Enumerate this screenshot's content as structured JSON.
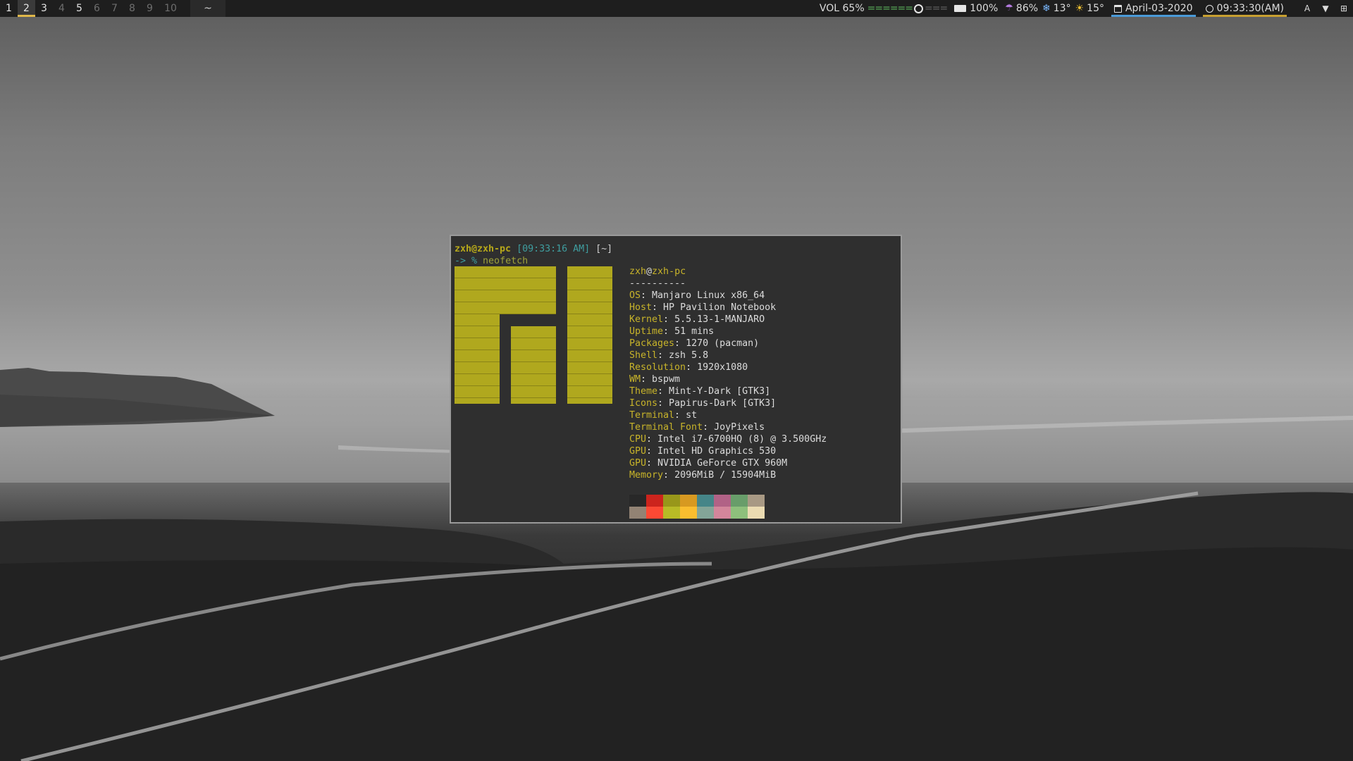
{
  "topbar": {
    "workspaces": [
      {
        "label": "1",
        "state": "occupied"
      },
      {
        "label": "2",
        "state": "active"
      },
      {
        "label": "3",
        "state": "occupied"
      },
      {
        "label": "4",
        "state": "empty"
      },
      {
        "label": "5",
        "state": "occupied"
      },
      {
        "label": "6",
        "state": "empty"
      },
      {
        "label": "7",
        "state": "empty"
      },
      {
        "label": "8",
        "state": "empty"
      },
      {
        "label": "9",
        "state": "empty"
      },
      {
        "label": "10",
        "state": "empty"
      }
    ],
    "window_title": "~",
    "volume": {
      "label": "VOL 65%",
      "level_fraction": 0.65,
      "bar_on": "======",
      "bar_off": "==="
    },
    "battery": {
      "label": "100%",
      "icon": "battery-icon"
    },
    "weather": {
      "humidity": "86%",
      "humidity_icon": "umbrella-icon",
      "low": "13°",
      "low_icon": "snowflake-icon",
      "high": "15°",
      "high_icon": "sun-icon"
    },
    "date": {
      "label": "April-03-2020",
      "icon": "calendar-icon"
    },
    "time": {
      "label": "09:33:30(AM)",
      "icon": "clock-icon"
    },
    "tray": [
      {
        "name": "input-method-icon",
        "glyph": "A"
      },
      {
        "name": "wifi-icon",
        "glyph": "▼"
      },
      {
        "name": "network-icon",
        "glyph": "⊞"
      }
    ],
    "colors": {
      "bar_bg": "#1e1e1e",
      "active_underline": "#e0b84a",
      "date_underline": "#4a9ad8",
      "time_underline": "#c8a030",
      "volume_green": "#5fb85f"
    }
  },
  "terminal": {
    "prompt": {
      "user_host": "zxh@zxh-pc",
      "time": "[09:33:16 AM]",
      "dir": "[~]",
      "arrow": "-> %",
      "command": "neofetch"
    },
    "info": {
      "user": "zxh",
      "at": "@",
      "host": "zxh-pc",
      "separator": "----------",
      "rows": [
        {
          "key": "OS",
          "value": "Manjaro Linux x86_64"
        },
        {
          "key": "Host",
          "value": "HP Pavilion Notebook"
        },
        {
          "key": "Kernel",
          "value": "5.5.13-1-MANJARO"
        },
        {
          "key": "Uptime",
          "value": "51 mins"
        },
        {
          "key": "Packages",
          "value": "1270 (pacman)"
        },
        {
          "key": "Shell",
          "value": "zsh 5.8"
        },
        {
          "key": "Resolution",
          "value": "1920x1080"
        },
        {
          "key": "WM",
          "value": "bspwm"
        },
        {
          "key": "Theme",
          "value": "Mint-Y-Dark [GTK3]"
        },
        {
          "key": "Icons",
          "value": "Papirus-Dark [GTK3]"
        },
        {
          "key": "Terminal",
          "value": "st"
        },
        {
          "key": "Terminal Font",
          "value": "JoyPixels"
        },
        {
          "key": "CPU",
          "value": "Intel i7-6700HQ (8) @ 3.500GHz"
        },
        {
          "key": "GPU",
          "value": "Intel HD Graphics 530"
        },
        {
          "key": "GPU",
          "value": "NVIDIA GeForce GTX 960M"
        },
        {
          "key": "Memory",
          "value": "2096MiB / 15904MiB"
        }
      ]
    },
    "palette": {
      "normal": [
        "#282828",
        "#cc241d",
        "#98971a",
        "#d79921",
        "#458588",
        "#b16286",
        "#689d6a",
        "#a89984"
      ],
      "bright": [
        "#928374",
        "#fb4934",
        "#b8bb26",
        "#fabd2f",
        "#83a598",
        "#d3869b",
        "#8ec07c",
        "#ebdbb2"
      ]
    },
    "logo_color": "#b0a81e"
  }
}
